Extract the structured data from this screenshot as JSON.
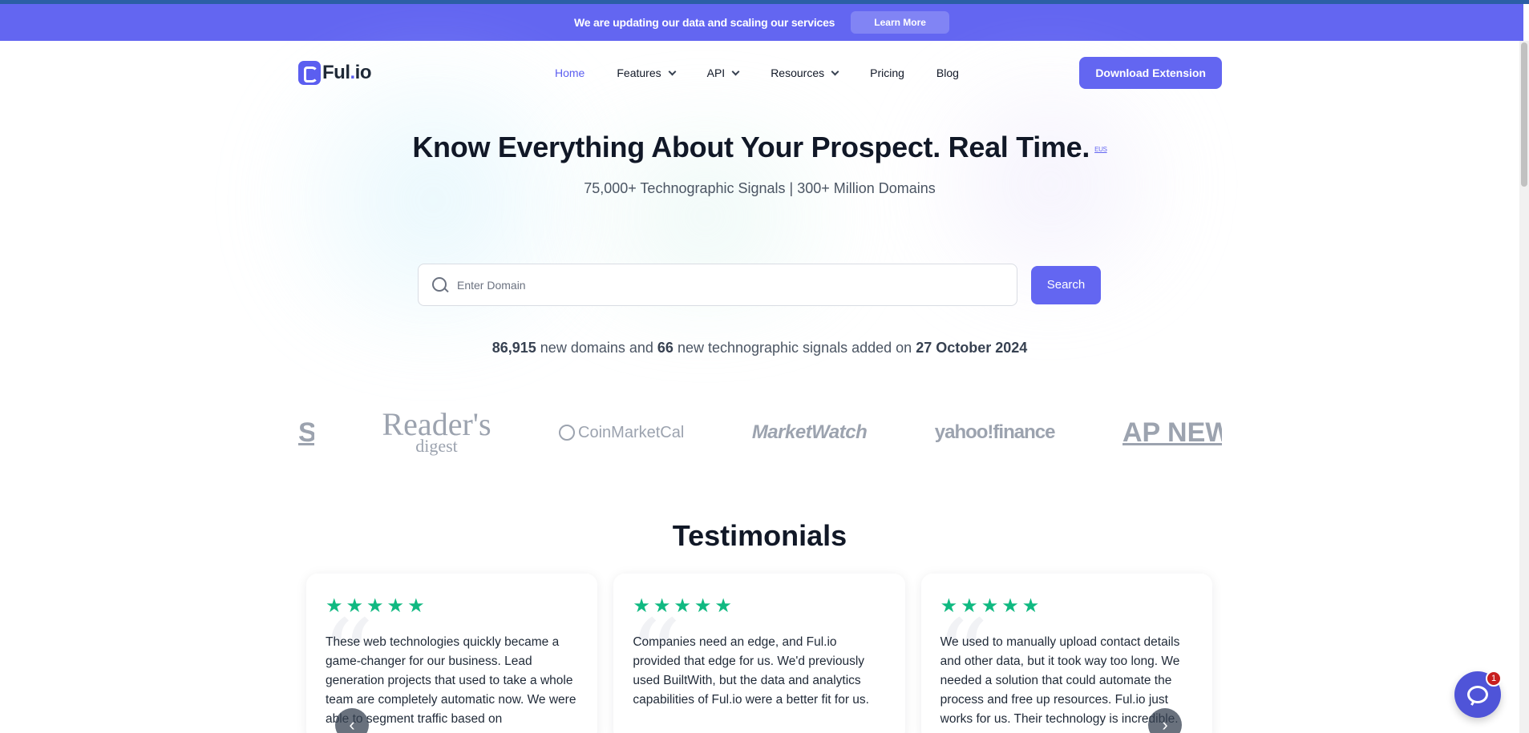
{
  "announcement": {
    "text": "We are updating our data and scaling our services",
    "button": "Learn More"
  },
  "header": {
    "logo_text_main": "Ful",
    "logo_text_dot": ".",
    "logo_text_end": "io",
    "nav": [
      {
        "label": "Home",
        "active": true,
        "dropdown": false
      },
      {
        "label": "Features",
        "active": false,
        "dropdown": true
      },
      {
        "label": "API",
        "active": false,
        "dropdown": true
      },
      {
        "label": "Resources",
        "active": false,
        "dropdown": true
      },
      {
        "label": "Pricing",
        "active": false,
        "dropdown": false
      },
      {
        "label": "Blog",
        "active": false,
        "dropdown": false
      }
    ],
    "cta": "Download Extension"
  },
  "hero": {
    "title": "Know Everything About Your Prospect. Real Time.",
    "badge": "EUS",
    "subtitle": "75,000+ Technographic Signals | 300+ Million Domains"
  },
  "search": {
    "placeholder": "Enter Domain",
    "button": "Search"
  },
  "stats": {
    "domains": "86,915",
    "domains_text": "new domains and",
    "signals": "66",
    "signals_text": "new technographic signals added on",
    "date": "27 October 2024"
  },
  "logos": {
    "partial_left": "S",
    "readers_top": "Reader's",
    "readers_bottom": "digest",
    "coinmarketcal": "CoinMarketCal",
    "marketwatch": "MarketWatch",
    "yahoo": "yahoo!finance",
    "ap": "AP NEWS"
  },
  "testimonials": {
    "title": "Testimonials",
    "cards": [
      {
        "stars": 5,
        "text": "These web technologies quickly became a game-changer for our business. Lead generation projects that used to take a whole team are completely automatic now. We were able to segment traffic based on"
      },
      {
        "stars": 5,
        "text": "Companies need an edge, and Ful.io provided that edge for us. We'd previously used BuiltWith, but the data and analytics capabilities of Ful.io were a better fit for us."
      },
      {
        "stars": 5,
        "text": "We used to manually upload contact details and other data, but it took way too long. We needed a solution that could automate the process and free up resources. Ful.io just works for us. Their technology is incredible."
      }
    ],
    "prev": "‹",
    "next": "›"
  },
  "chat": {
    "badge_count": "1"
  },
  "colors": {
    "accent": "#6366f1",
    "star": "#10b981",
    "banner": "#6366f1"
  }
}
